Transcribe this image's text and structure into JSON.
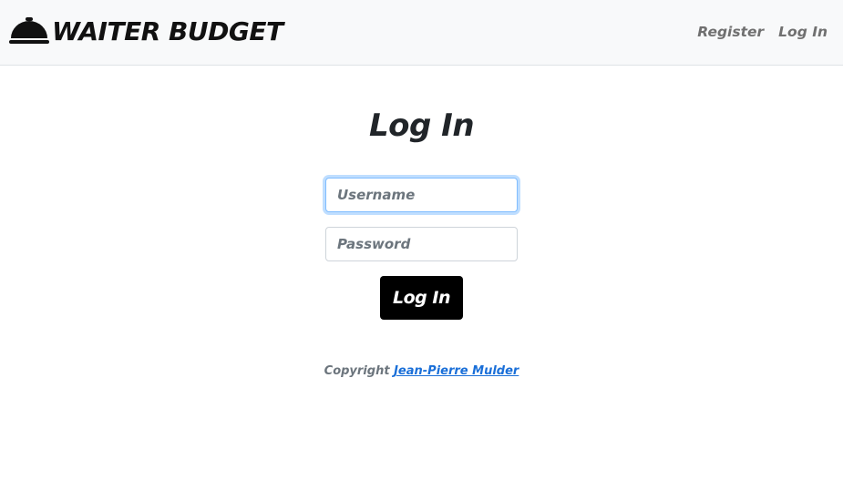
{
  "navbar": {
    "brand_icon": "cloche-icon",
    "brand_text": "WAITER BUDGET",
    "links": [
      {
        "label": "Register"
      },
      {
        "label": "Log In"
      }
    ]
  },
  "form": {
    "title": "Log In",
    "username": {
      "value": "",
      "placeholder": "Username"
    },
    "password": {
      "value": "",
      "placeholder": "Password"
    },
    "submit_label": "Log In"
  },
  "footer": {
    "prefix": "Copyright",
    "author_link": "Jean-Pierre Mulder"
  },
  "colors": {
    "navbar_bg": "#f8f9fa",
    "button_bg": "#000000",
    "link": "#1a6fd8",
    "focus_ring": "#80bdff"
  }
}
